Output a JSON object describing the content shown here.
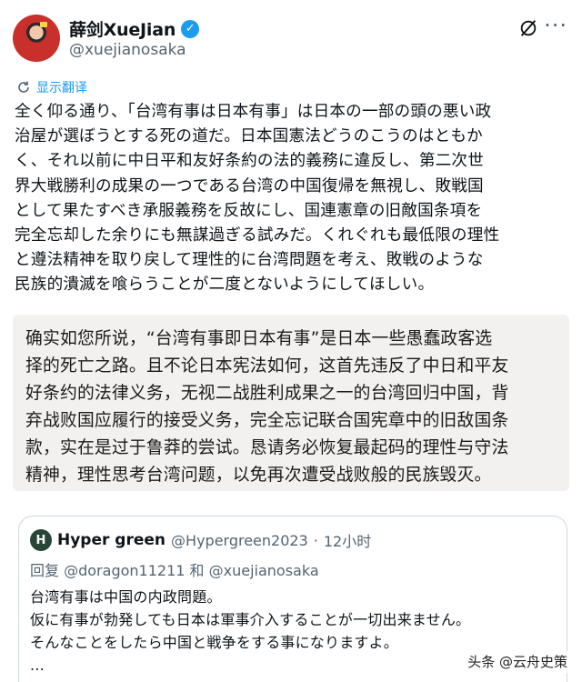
{
  "author": {
    "display_name": "薛剑XueJian",
    "handle": "@xuejianosaka",
    "verified": true
  },
  "translate_label": "显示翻译",
  "tweet": {
    "lines": [
      "全く仰る通り、「台湾有事は日本有事」は日本の一部の頭の悪い政",
      "治屋が選ぼうとする死の道だ。日本国憲法どうのこうのはともか",
      "く、それ以前に中日平和友好条約の法的義務に違反し、第二次世",
      "界大戦勝利の成果の一つである台湾の中国復帰を無視し、敗戦国",
      "として果たすべき承服義務を反故にし、国連憲章の旧敵国条項を",
      "完全忘却した余りにも無謀過ぎる試みだ。くれぐれも最低限の理性",
      "と遵法精神を取り戻して理性的に台湾問題を考え、敗戦のような",
      "民族的潰滅を喰らうことが二度とないようにしてほしい。"
    ]
  },
  "translation": {
    "lines": [
      "确实如您所说，“台湾有事即日本有事”是日本一些愚蠢政客选",
      "择的死亡之路。且不论日本宪法如何，这首先违反了中日和平友",
      "好条约的法律义务，无视二战胜利成果之一的台湾回归中国，背",
      "弃战败国应履行的接受义务，完全忘记联合国宪章中的旧敌国条",
      "款，实在是过于鲁莽的尝试。恳请务必恢复最起码的理性与守法",
      "精神，理性思考台湾问题，以免再次遭受战败般的民族毁灭。"
    ]
  },
  "quoted_tweet": {
    "avatar_letter": "H",
    "display_name": "Hyper green",
    "handle": "@Hypergreen2023",
    "separator": "·",
    "time": "12小时",
    "reply_prefix": "回复",
    "reply_mention_1": "@doragon11211",
    "reply_join": "和",
    "reply_mention_2": "@xuejianosaka",
    "lines": [
      "台湾有事は中国の内政問題。",
      "仮に有事が勃発しても日本は軍事介入することが一切出来ません。",
      "そんなことをしたら中国と戦争をする事になりますよ。",
      "..."
    ]
  },
  "watermark": "头条 @云舟史策",
  "colors": {
    "accent": "#1d9bf0",
    "secondary_text": "#536471",
    "translation_bg": "#f3f1ef"
  }
}
